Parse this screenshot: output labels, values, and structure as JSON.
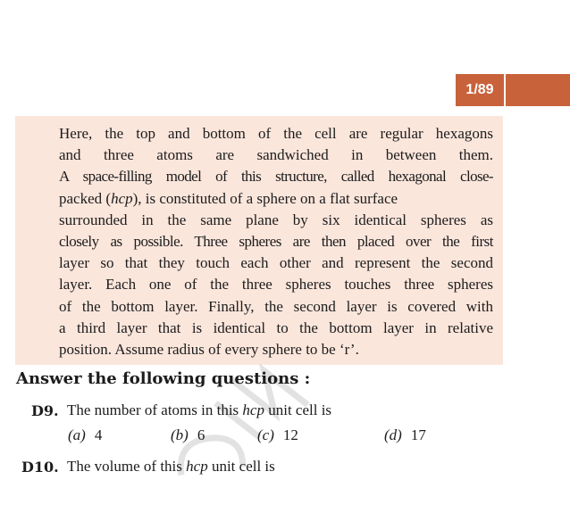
{
  "page_number": "1/89",
  "passage": [
    {
      "text": "Here, the top and bottom of the cell are regular hexagons"
    },
    {
      "text": "and three atoms are sandwiched in between them."
    },
    {
      "text": "A space-filling model of this structure, called hexagonal close-"
    },
    {
      "text": "packed ("
    },
    {
      "text": "hcp"
    },
    {
      "text": "), is constituted of a sphere on a flat surface"
    },
    {
      "text": "surrounded in the same plane by six identical spheres as"
    },
    {
      "text": "closely as possible. Three spheres are then placed over the first"
    },
    {
      "text": "layer so that they touch each other and represent the second"
    },
    {
      "text": "layer. Each one of the three spheres touches three spheres"
    },
    {
      "text": "of the bottom layer. Finally, the second layer is covered with"
    },
    {
      "text": "a third layer that is identical to the bottom layer in relative"
    },
    {
      "text": "position. Assume radius of every sphere to be ‘r’."
    }
  ],
  "heading": "Answer the following questions :",
  "questions": [
    {
      "number": "D9.",
      "text_before": "The number of atoms in this ",
      "text_italic": "hcp",
      "text_after": " unit cell is",
      "options": [
        {
          "label": "(a)",
          "value": "4"
        },
        {
          "label": "(b)",
          "value": "6"
        },
        {
          "label": "(c)",
          "value": "12"
        },
        {
          "label": "(d)",
          "value": "17"
        }
      ]
    },
    {
      "number": "D10.",
      "text_before": "The volume of this ",
      "text_italic": "hcp",
      "text_after": " unit cell is"
    }
  ]
}
